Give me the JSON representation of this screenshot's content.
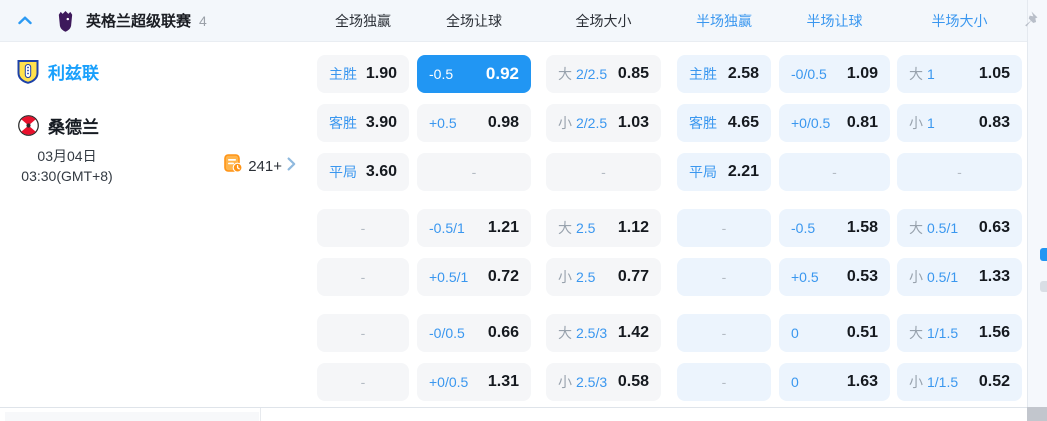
{
  "header": {
    "league": "英格兰超级联赛",
    "match_count": "4",
    "columns": [
      "全场独赢",
      "全场让球",
      "全场大小",
      "半场独赢",
      "半场让球",
      "半场大小"
    ]
  },
  "match": {
    "home_team": "利兹联",
    "away_team": "桑德兰",
    "date": "03月04日",
    "time": "03:30(GMT+8)",
    "more_markets": "241+"
  },
  "odds": {
    "groups": [
      3,
      2,
      2
    ],
    "rows": [
      [
        {
          "label": "主胜",
          "value": "1.90"
        },
        {
          "label": "-0.5",
          "value": "0.92",
          "highlighted": true
        },
        {
          "pre": "大",
          "label": "2/2.5",
          "value": "0.85"
        },
        {
          "label": "主胜",
          "value": "2.58"
        },
        {
          "label": "-0/0.5",
          "value": "1.09"
        },
        {
          "pre": "大",
          "label": "1",
          "value": "1.05"
        }
      ],
      [
        {
          "label": "客胜",
          "value": "3.90"
        },
        {
          "label": "+0.5",
          "value": "0.98"
        },
        {
          "pre": "小",
          "label": "2/2.5",
          "value": "1.03"
        },
        {
          "label": "客胜",
          "value": "4.65"
        },
        {
          "label": "+0/0.5",
          "value": "0.81"
        },
        {
          "pre": "小",
          "label": "1",
          "value": "0.83"
        }
      ],
      [
        {
          "label": "平局",
          "value": "3.60"
        },
        {
          "value": "-"
        },
        {
          "value": "-"
        },
        {
          "label": "平局",
          "value": "2.21"
        },
        {
          "value": "-"
        },
        {
          "value": "-"
        }
      ],
      [
        {
          "value": "-"
        },
        {
          "label": "-0.5/1",
          "value": "1.21"
        },
        {
          "pre": "大",
          "label": "2.5",
          "value": "1.12"
        },
        {
          "value": "-"
        },
        {
          "label": "-0.5",
          "value": "1.58"
        },
        {
          "pre": "大",
          "label": "0.5/1",
          "value": "0.63"
        }
      ],
      [
        {
          "value": "-"
        },
        {
          "label": "+0.5/1",
          "value": "0.72"
        },
        {
          "pre": "小",
          "label": "2.5",
          "value": "0.77"
        },
        {
          "value": "-"
        },
        {
          "label": "+0.5",
          "value": "0.53"
        },
        {
          "pre": "小",
          "label": "0.5/1",
          "value": "1.33"
        }
      ],
      [
        {
          "value": "-"
        },
        {
          "label": "-0/0.5",
          "value": "0.66"
        },
        {
          "pre": "大",
          "label": "2.5/3",
          "value": "1.42"
        },
        {
          "value": "-"
        },
        {
          "label": "0",
          "value": "0.51"
        },
        {
          "pre": "大",
          "label": "1/1.5",
          "value": "1.56"
        }
      ],
      [
        {
          "value": "-"
        },
        {
          "label": "+0/0.5",
          "value": "1.31"
        },
        {
          "pre": "小",
          "label": "2.5/3",
          "value": "0.58"
        },
        {
          "value": "-"
        },
        {
          "label": "0",
          "value": "1.63"
        },
        {
          "pre": "小",
          "label": "1/1.5",
          "value": "0.52"
        }
      ]
    ]
  },
  "colors": {
    "accent_blue": "#2196f3",
    "label_blue": "#3a97ef",
    "home_team_blue": "#19a0fc",
    "fulltime_cell_bg": "#f5f6f8",
    "halftime_cell_bg": "#ecf4fd",
    "header_bg": "#f3f7fb",
    "orange": "#ff9416",
    "prefix_gray": "#98a2ad"
  }
}
